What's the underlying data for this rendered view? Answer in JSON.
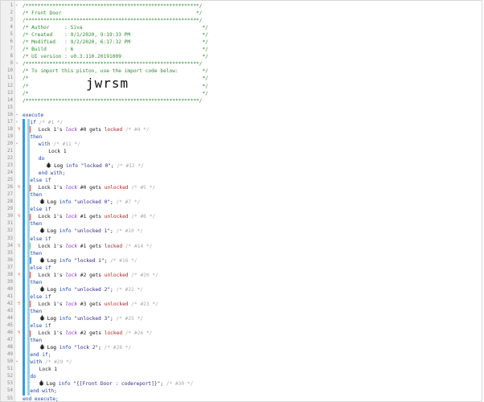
{
  "code_lines": [
    {
      "n": "1",
      "parts": [
        [
          "c-comment",
          "/**********************************************************/"
        ]
      ]
    },
    {
      "n": "2",
      "parts": [
        [
          "c-comment",
          "/* Front Door                                             */"
        ]
      ]
    },
    {
      "n": "3",
      "parts": [
        [
          "c-comment",
          "/**********************************************************/"
        ]
      ]
    },
    {
      "n": "4",
      "parts": [
        [
          "c-comment",
          "/* Author     : Siva                                        */"
        ]
      ]
    },
    {
      "n": "5",
      "parts": [
        [
          "c-comment",
          "/* Created    : 9/1/2020, 9:19:33 PM                        */"
        ]
      ]
    },
    {
      "n": "6",
      "parts": [
        [
          "c-comment",
          "/* Modified   : 9/2/2020, 6:17:32 PM                        */"
        ]
      ]
    },
    {
      "n": "7",
      "parts": [
        [
          "c-comment",
          "/* Build      : 6                                           */"
        ]
      ]
    },
    {
      "n": "8",
      "parts": [
        [
          "c-comment",
          "/* UI version : v0.3.110.20191009                           */"
        ]
      ]
    },
    {
      "n": "9",
      "parts": [
        [
          "c-comment",
          "/**********************************************************/"
        ]
      ]
    },
    {
      "n": "10",
      "parts": [
        [
          "c-comment",
          "/* To import this piston, use the import code below:        */"
        ]
      ]
    },
    {
      "n": "11",
      "parts": [
        [
          "c-comment",
          "/*                                                          */"
        ]
      ]
    },
    {
      "n": "12",
      "parts": [
        [
          "c-comment",
          "/*                                                          */"
        ]
      ]
    },
    {
      "n": "13",
      "parts": [
        [
          "c-comment",
          "/*                                                          */"
        ]
      ]
    },
    {
      "n": "14",
      "parts": [
        [
          "c-comment",
          "/**********************************************************/"
        ]
      ]
    },
    {
      "n": "15",
      "parts": []
    },
    {
      "n": "16",
      "parts": [
        [
          "c-kw",
          "execute"
        ]
      ]
    },
    {
      "n": "17",
      "parts": [
        [
          "c-kw",
          "if "
        ],
        [
          "c-comment-light",
          "/* #1 */"
        ]
      ]
    },
    {
      "n": "18",
      "parts": [
        [
          "c-plain",
          "Lock 1"
        ],
        [
          "c-plain",
          "'s "
        ],
        [
          "c-var",
          "lock"
        ],
        [
          "c-plain",
          " #0 gets "
        ],
        [
          "c-red",
          "locked"
        ],
        [
          "c-comment-light",
          " /* #4 */"
        ]
      ]
    },
    {
      "n": "19",
      "parts": [
        [
          "c-kw",
          "then"
        ]
      ]
    },
    {
      "n": "20",
      "parts": [
        [
          "c-kw",
          "with "
        ],
        [
          "c-comment-light",
          "/* #11 */"
        ]
      ]
    },
    {
      "n": "21",
      "parts": [
        [
          "c-plain",
          "Lock 1"
        ]
      ]
    },
    {
      "n": "22",
      "parts": [
        [
          "c-kw",
          "do"
        ]
      ]
    },
    {
      "n": "23",
      "parts": [
        [
          "c-black",
          "Log "
        ],
        [
          "c-kw",
          "info "
        ],
        [
          "c-str",
          "\"locked 0\""
        ],
        [
          "c-plain",
          "; "
        ],
        [
          "c-comment-light",
          "/* #12 */"
        ]
      ]
    },
    {
      "n": "24",
      "parts": [
        [
          "c-kw",
          "end with;"
        ]
      ]
    },
    {
      "n": "25",
      "parts": [
        [
          "c-kw",
          "else if"
        ]
      ]
    },
    {
      "n": "26",
      "parts": [
        [
          "c-plain",
          "Lock 1"
        ],
        [
          "c-plain",
          "'s "
        ],
        [
          "c-var",
          "lock"
        ],
        [
          "c-plain",
          " #0 gets "
        ],
        [
          "c-red",
          "unlocked"
        ],
        [
          "c-comment-light",
          " /* #5 */"
        ]
      ]
    },
    {
      "n": "27",
      "parts": [
        [
          "c-kw",
          "then"
        ]
      ]
    },
    {
      "n": "28",
      "parts": [
        [
          "c-black",
          "Log "
        ],
        [
          "c-kw",
          "info "
        ],
        [
          "c-str",
          "\"unlocked 0\""
        ],
        [
          "c-plain",
          "; "
        ],
        [
          "c-comment-light",
          "/* #7 */"
        ]
      ]
    },
    {
      "n": "29",
      "parts": [
        [
          "c-kw",
          "else if"
        ]
      ]
    },
    {
      "n": "30",
      "parts": [
        [
          "c-plain",
          "Lock 1"
        ],
        [
          "c-plain",
          "'s "
        ],
        [
          "c-var",
          "lock"
        ],
        [
          "c-plain",
          " #1 gets "
        ],
        [
          "c-red",
          "unlocked"
        ],
        [
          "c-comment-light",
          " /* #8 */"
        ]
      ]
    },
    {
      "n": "31",
      "parts": [
        [
          "c-kw",
          "then"
        ]
      ]
    },
    {
      "n": "32",
      "parts": [
        [
          "c-black",
          "Log "
        ],
        [
          "c-kw",
          "info "
        ],
        [
          "c-str",
          "\"unlocked 1\""
        ],
        [
          "c-plain",
          "; "
        ],
        [
          "c-comment-light",
          "/* #10 */"
        ]
      ]
    },
    {
      "n": "33",
      "parts": [
        [
          "c-kw",
          "else if"
        ]
      ]
    },
    {
      "n": "34",
      "parts": [
        [
          "c-plain",
          "Lock 1"
        ],
        [
          "c-plain",
          "'s "
        ],
        [
          "c-var",
          "lock"
        ],
        [
          "c-plain",
          " #1 gets "
        ],
        [
          "c-red",
          "locked"
        ],
        [
          "c-comment-light",
          " /* #14 */"
        ]
      ]
    },
    {
      "n": "35",
      "parts": [
        [
          "c-kw",
          "then"
        ]
      ]
    },
    {
      "n": "36",
      "parts": [
        [
          "c-black",
          "Log "
        ],
        [
          "c-kw",
          "info "
        ],
        [
          "c-str",
          "\"locked 1\""
        ],
        [
          "c-plain",
          "; "
        ],
        [
          "c-comment-light",
          "/* #16 */"
        ]
      ]
    },
    {
      "n": "37",
      "parts": [
        [
          "c-kw",
          "else if"
        ]
      ]
    },
    {
      "n": "38",
      "parts": [
        [
          "c-plain",
          "Lock 1"
        ],
        [
          "c-plain",
          "'s "
        ],
        [
          "c-var",
          "lock"
        ],
        [
          "c-plain",
          " #2 gets "
        ],
        [
          "c-red",
          "unlocked"
        ],
        [
          "c-comment-light",
          " /* #20 */"
        ]
      ]
    },
    {
      "n": "39",
      "parts": [
        [
          "c-kw",
          "then"
        ]
      ]
    },
    {
      "n": "40",
      "parts": [
        [
          "c-black",
          "Log "
        ],
        [
          "c-kw",
          "info "
        ],
        [
          "c-str",
          "\"unlocked 2\""
        ],
        [
          "c-plain",
          "; "
        ],
        [
          "c-comment-light",
          "/* #22 */"
        ]
      ]
    },
    {
      "n": "41",
      "parts": [
        [
          "c-kw",
          "else if"
        ]
      ]
    },
    {
      "n": "42",
      "parts": [
        [
          "c-plain",
          "Lock 1"
        ],
        [
          "c-plain",
          "'s "
        ],
        [
          "c-var",
          "lock"
        ],
        [
          "c-plain",
          " #3 gets "
        ],
        [
          "c-red",
          "unlocked"
        ],
        [
          "c-comment-light",
          " /* #23 */"
        ]
      ]
    },
    {
      "n": "43",
      "parts": [
        [
          "c-kw",
          "then"
        ]
      ]
    },
    {
      "n": "44",
      "parts": [
        [
          "c-black",
          "Log "
        ],
        [
          "c-kw",
          "info "
        ],
        [
          "c-str",
          "\"unlocked 3\""
        ],
        [
          "c-plain",
          "; "
        ],
        [
          "c-comment-light",
          "/* #25 */"
        ]
      ]
    },
    {
      "n": "45",
      "parts": [
        [
          "c-kw",
          "else if"
        ]
      ]
    },
    {
      "n": "46",
      "parts": [
        [
          "c-plain",
          "Lock 1"
        ],
        [
          "c-plain",
          "'s "
        ],
        [
          "c-var",
          "lock"
        ],
        [
          "c-plain",
          " #2 gets "
        ],
        [
          "c-red",
          "locked"
        ],
        [
          "c-comment-light",
          " /* #26 */"
        ]
      ]
    },
    {
      "n": "47",
      "parts": [
        [
          "c-kw",
          "then"
        ]
      ]
    },
    {
      "n": "48",
      "parts": [
        [
          "c-black",
          "Log "
        ],
        [
          "c-kw",
          "info "
        ],
        [
          "c-str",
          "\"lock 2\""
        ],
        [
          "c-plain",
          "; "
        ],
        [
          "c-comment-light",
          "/* #28 */"
        ]
      ]
    },
    {
      "n": "49",
      "parts": [
        [
          "c-kw",
          "end if;"
        ]
      ]
    },
    {
      "n": "50",
      "parts": [
        [
          "c-kw",
          "with "
        ],
        [
          "c-comment-light",
          "/* #29 */"
        ]
      ]
    },
    {
      "n": "51",
      "parts": [
        [
          "c-plain",
          "Lock 1"
        ]
      ]
    },
    {
      "n": "52",
      "parts": [
        [
          "c-kw",
          "do"
        ]
      ]
    },
    {
      "n": "53",
      "parts": [
        [
          "c-black",
          "Log "
        ],
        [
          "c-kw",
          "info "
        ],
        [
          "c-str",
          "\"{[Front Door : codereport]}\""
        ],
        [
          "c-plain",
          "; "
        ],
        [
          "c-comment-light",
          "/* #30 */"
        ]
      ]
    },
    {
      "n": "54",
      "parts": [
        [
          "c-kw",
          "end with;"
        ]
      ]
    },
    {
      "n": "55",
      "parts": [
        [
          "c-kw",
          "end execute;"
        ]
      ]
    }
  ],
  "import_code": "jwrsm",
  "colors": {
    "comment": "#2e8b2e",
    "keyword": "#1a3fb0",
    "state": "#b22222",
    "bar_blue": "#3a9ad9",
    "marker_red": "#e74c3c",
    "marker_green": "#6fd06f"
  },
  "icons": [
    "trigger-bolt-icon",
    "log-bug-icon",
    "fold-arrow-icon"
  ]
}
